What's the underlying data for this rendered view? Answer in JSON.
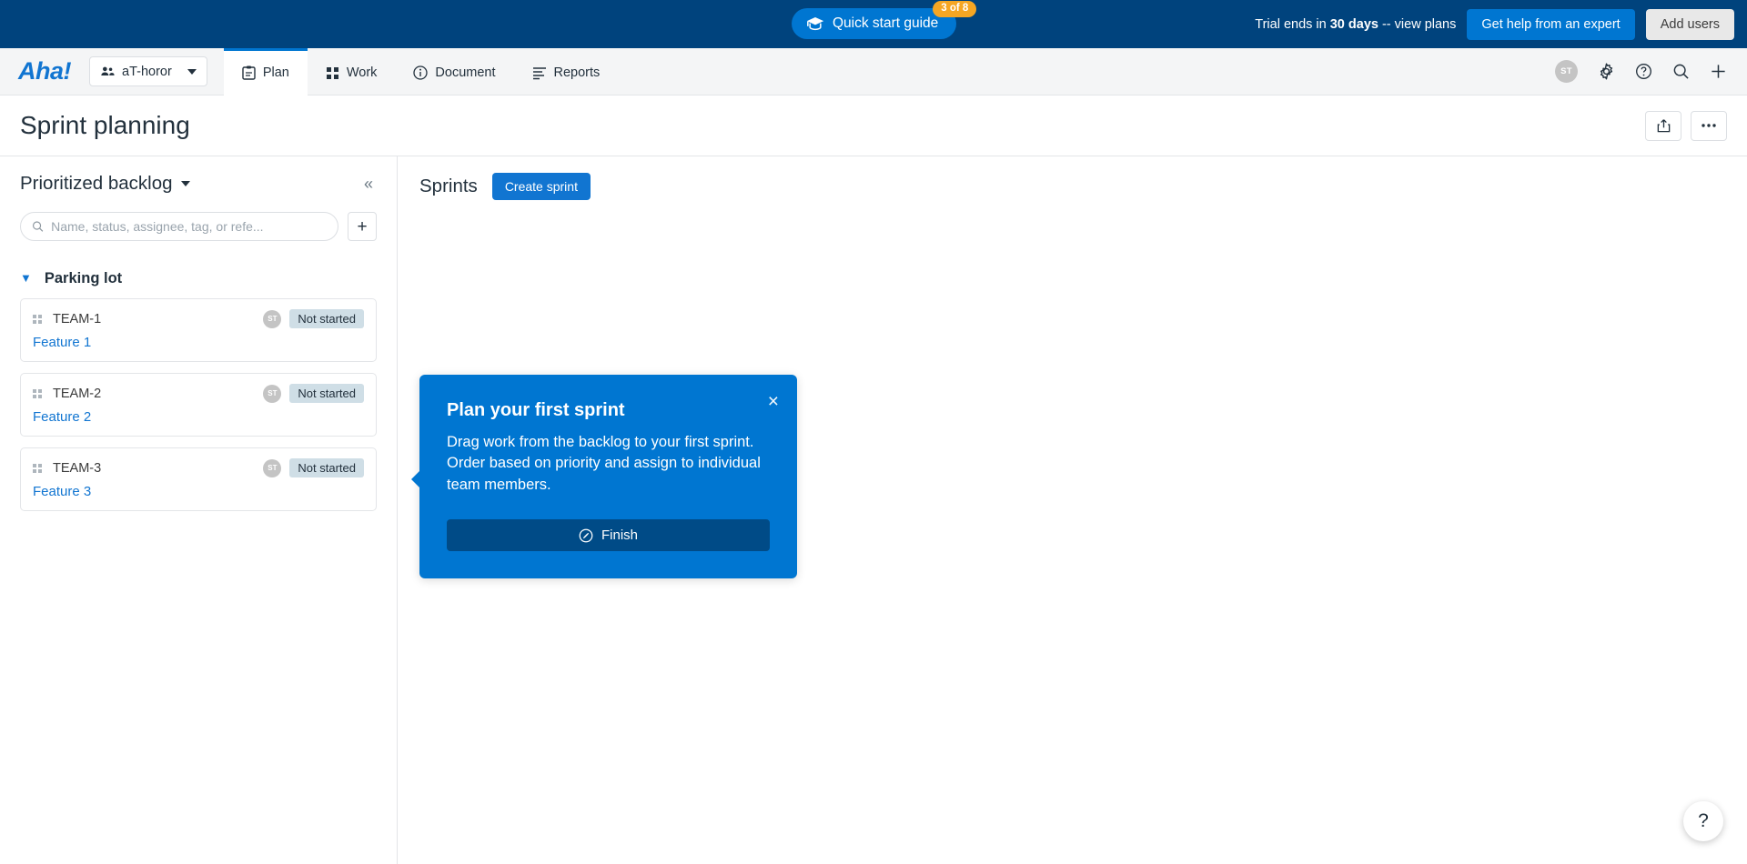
{
  "topbar": {
    "quick_start": {
      "label": "Quick start guide",
      "badge": "3 of 8",
      "icon": "graduation-cap-icon"
    },
    "trial_prefix": "Trial ends in ",
    "trial_days": "30 days",
    "trial_suffix": " -- view plans",
    "expert_button": "Get help from an expert",
    "add_users_button": "Add users"
  },
  "nav": {
    "logo": "Aha!",
    "workspace": "aT-horor",
    "tabs": [
      {
        "label": "Plan",
        "icon": "clipboard-icon",
        "active": true
      },
      {
        "label": "Work",
        "icon": "grid-icon",
        "active": false
      },
      {
        "label": "Document",
        "icon": "info-circle-icon",
        "active": false
      },
      {
        "label": "Reports",
        "icon": "list-icon",
        "active": false
      }
    ],
    "avatar_initials": "ST",
    "right_icons": [
      "gear-icon",
      "help-circle-icon",
      "search-icon",
      "plus-icon"
    ]
  },
  "page": {
    "title": "Sprint planning",
    "actions": [
      "share-icon",
      "more-options-icon"
    ]
  },
  "sidebar": {
    "title": "Prioritized backlog",
    "collapse_glyph": "«",
    "search_placeholder": "Name, status, assignee, tag, or refe...",
    "search_value": "",
    "add_glyph": "+",
    "group": {
      "label": "Parking lot",
      "expanded": true
    },
    "cards": [
      {
        "reference": "TEAM-1",
        "name": "Feature 1",
        "assignee": "ST",
        "status": "Not started"
      },
      {
        "reference": "TEAM-2",
        "name": "Feature 2",
        "assignee": "ST",
        "status": "Not started"
      },
      {
        "reference": "TEAM-3",
        "name": "Feature 3",
        "assignee": "ST",
        "status": "Not started"
      }
    ]
  },
  "main": {
    "sprints_title": "Sprints",
    "create_sprint_button": "Create sprint"
  },
  "popover": {
    "title": "Plan your first sprint",
    "body": "Drag work from the backlog to your first sprint. Order based on priority and assign to individual team members.",
    "button_label": "Finish",
    "button_icon": "compass-icon",
    "close_glyph": "×"
  },
  "help_fab": {
    "glyph": "?"
  },
  "colors": {
    "top_bar": "#00437d",
    "accent_blue": "#0076d1",
    "logo_blue": "#1175d1",
    "badge_orange": "#f5a623",
    "status_badge": "#cfdee6",
    "popover_button": "#004b87"
  }
}
